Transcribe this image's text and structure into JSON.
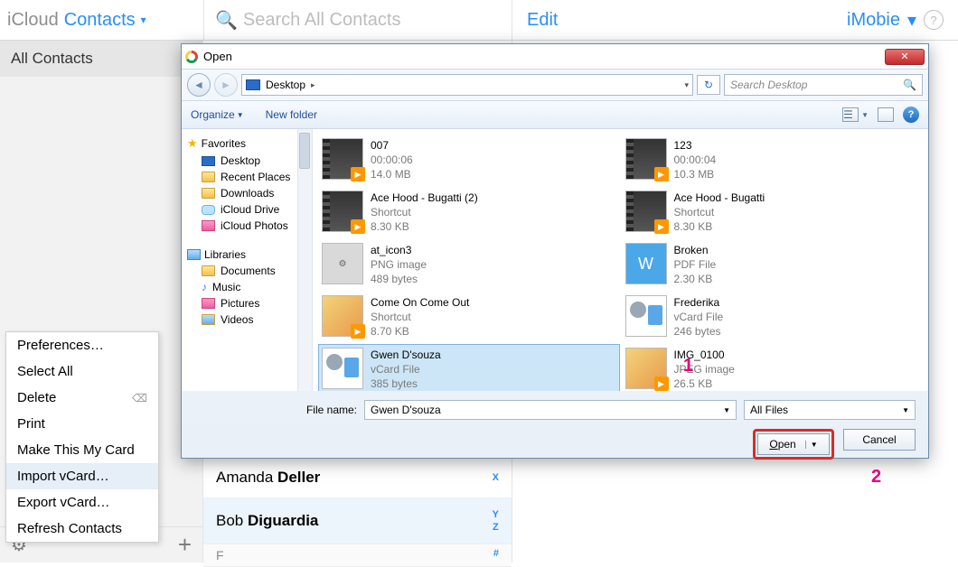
{
  "header": {
    "icloud": "iCloud",
    "contacts": "Contacts",
    "search_ph": "Search All Contacts",
    "edit": "Edit",
    "brand": "iMobie"
  },
  "sidebar": {
    "all": "All Contacts"
  },
  "context": {
    "items": [
      "Preferences…",
      "Select All",
      "Delete",
      "Print",
      "Make This My Card",
      "Import vCard…",
      "Export vCard…",
      "Refresh Contacts"
    ],
    "highlight": 5
  },
  "contacts": {
    "rows": [
      {
        "first": "Amanda ",
        "last": "Deller",
        "idx": "X"
      },
      {
        "first": "Bob ",
        "last": "Diguardia",
        "idx": "Y"
      }
    ],
    "letter": "F",
    "letter_idx": "#",
    "z": "Z"
  },
  "dialog": {
    "title": "Open",
    "bc": "Desktop",
    "search_ph": "Search Desktop",
    "organize": "Organize",
    "newfolder": "New folder",
    "fav": "Favorites",
    "fav_items": [
      "Desktop",
      "Recent Places",
      "Downloads",
      "iCloud Drive",
      "iCloud Photos"
    ],
    "lib": "Libraries",
    "lib_items": [
      "Documents",
      "Music",
      "Pictures",
      "Videos"
    ],
    "files": [
      {
        "n": "007",
        "t": "00:00:06",
        "s": "14.0 MB",
        "k": "vid"
      },
      {
        "n": "123",
        "t": "00:00:04",
        "s": "10.3 MB",
        "k": "vid"
      },
      {
        "n": "Ace Hood - Bugatti (2)",
        "t": "Shortcut",
        "s": "8.30 KB",
        "k": "vid"
      },
      {
        "n": "Ace Hood - Bugatti",
        "t": "Shortcut",
        "s": "8.30 KB",
        "k": "vid"
      },
      {
        "n": "at_icon3",
        "t": "PNG image",
        "s": "489 bytes",
        "k": "png"
      },
      {
        "n": "Broken",
        "t": "PDF File",
        "s": "2.30 KB",
        "k": "pdf"
      },
      {
        "n": "Come On Come Out",
        "t": "Shortcut",
        "s": "8.70 KB",
        "k": "img"
      },
      {
        "n": "Frederika",
        "t": "vCard File",
        "s": "246 bytes",
        "k": "vc"
      },
      {
        "n": "Gwen  D'souza",
        "t": "vCard File",
        "s": "385 bytes",
        "k": "vc",
        "sel": true
      },
      {
        "n": "IMG_0100",
        "t": "JPEG image",
        "s": "26.5 KB",
        "k": "img"
      }
    ],
    "fn_label": "File name:",
    "fn_value": "Gwen  D'souza",
    "ftype": "All Files",
    "open": "Open",
    "cancel": "Cancel"
  },
  "markers": {
    "m1": "1",
    "m2": "2"
  }
}
